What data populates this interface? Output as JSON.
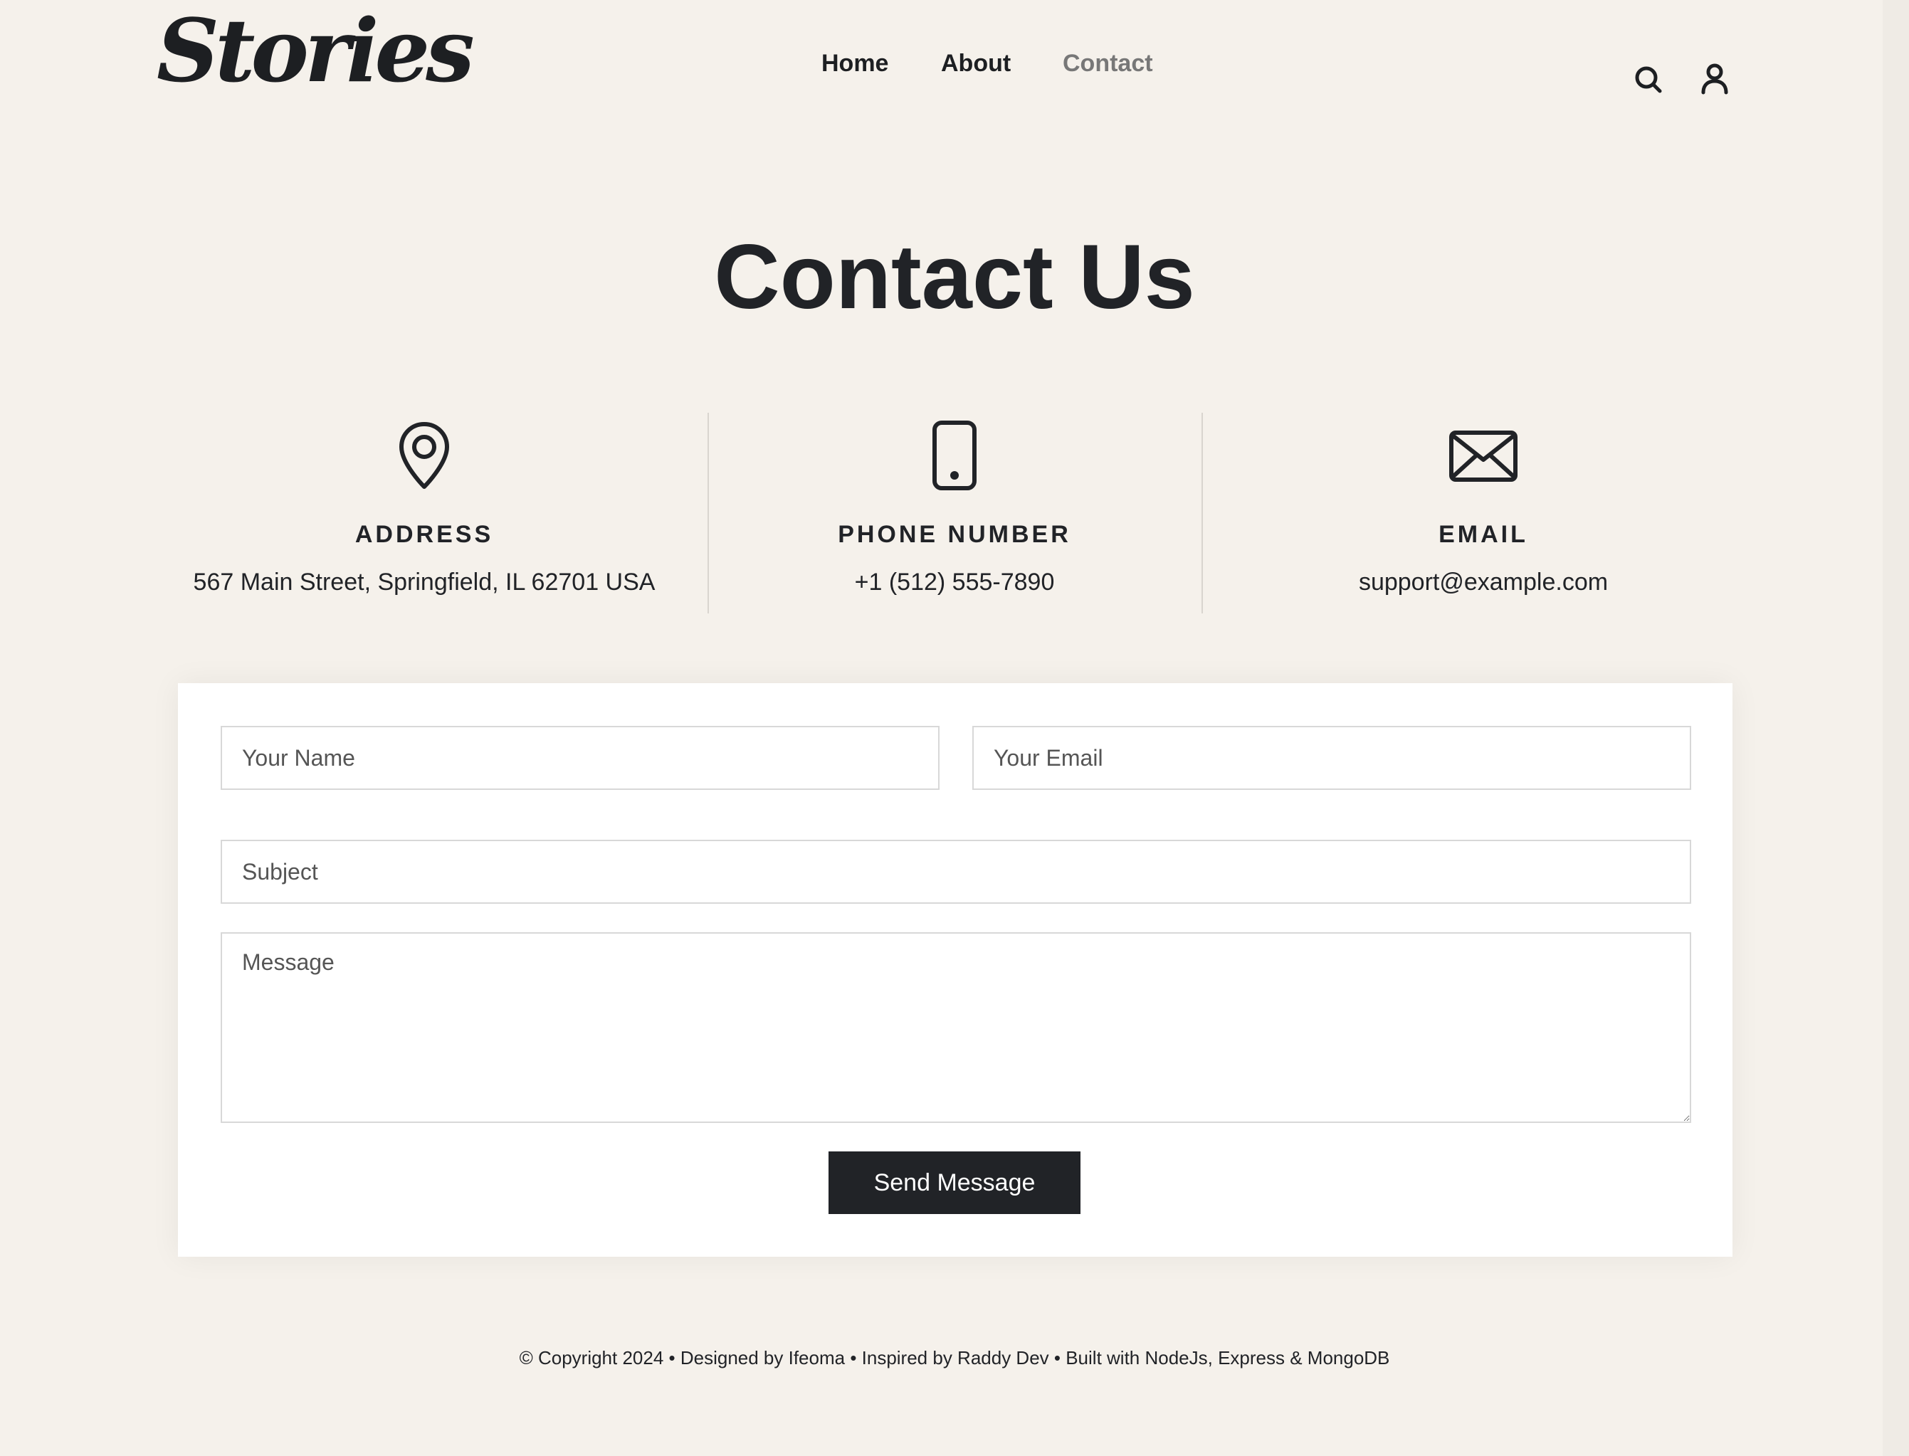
{
  "brand": {
    "logo": "Stories"
  },
  "nav": {
    "items": [
      "Home",
      "About",
      "Contact"
    ],
    "active": "Contact"
  },
  "header": {
    "icons": [
      "search-icon",
      "user-icon"
    ]
  },
  "page": {
    "title": "Contact Us"
  },
  "contact_info": [
    {
      "icon": "location-pin-icon",
      "label": "ADDRESS",
      "value": "567 Main Street, Springfield, IL 62701 USA"
    },
    {
      "icon": "phone-icon",
      "label": "PHONE NUMBER",
      "value": "+1 (512) 555-7890"
    },
    {
      "icon": "envelope-icon",
      "label": "EMAIL",
      "value": "support@example.com"
    }
  ],
  "form": {
    "name_placeholder": "Your Name",
    "email_placeholder": "Your Email",
    "subject_placeholder": "Subject",
    "message_placeholder": "Message",
    "submit_label": "Send Message"
  },
  "footer": {
    "text": "© Copyright 2024 • Designed by Ifeoma • Inspired by Raddy Dev • Built with NodeJs, Express & MongoDB"
  },
  "colors": {
    "background": "#f5f1eb",
    "text": "#212327",
    "nav_active": "#777777",
    "button": "#212327",
    "card": "#ffffff"
  }
}
